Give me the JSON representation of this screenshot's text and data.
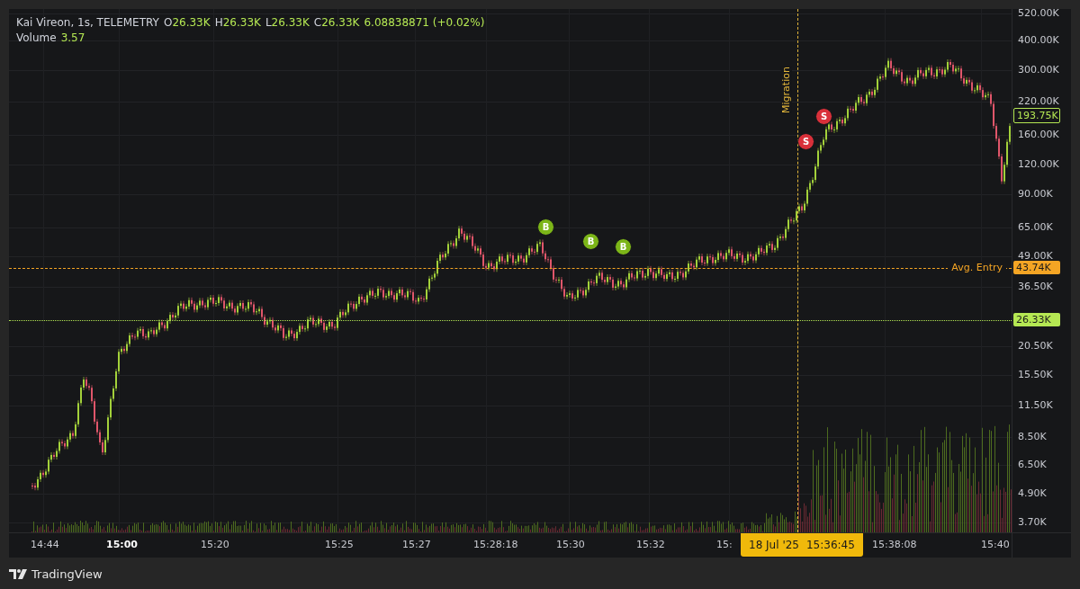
{
  "legend": {
    "title": "Kai Vireon, 1s, TELEMETRY",
    "ohlc": [
      {
        "label": "O",
        "value": "26.33K"
      },
      {
        "label": "H",
        "value": "26.33K"
      },
      {
        "label": "L",
        "value": "26.33K"
      },
      {
        "label": "C",
        "value": "26.33K"
      }
    ],
    "change": "6.08838871 (+0.02%)",
    "volume_label": "Volume",
    "volume_value": "3.57"
  },
  "price_axis": {
    "ticks": [
      "520.00K",
      "400.00K",
      "300.00K",
      "220.00K",
      "160.00K",
      "120.00K",
      "90.00K",
      "65.00K",
      "49.00K",
      "36.50K",
      "20.50K",
      "15.50K",
      "11.50K",
      "8.50K",
      "6.50K",
      "4.90K",
      "3.70K"
    ]
  },
  "price_lines": [
    {
      "kind": "current",
      "value": "193.75K"
    },
    {
      "kind": "avg_entry",
      "label": "Avg. Entry",
      "value": "43.74K"
    },
    {
      "kind": "last",
      "value": "26.33K"
    }
  ],
  "markers": [
    {
      "kind": "buy",
      "text": "B"
    },
    {
      "kind": "buy",
      "text": "B"
    },
    {
      "kind": "buy",
      "text": "B"
    },
    {
      "kind": "sell",
      "text": "S"
    },
    {
      "kind": "sell",
      "text": "S"
    }
  ],
  "event": {
    "label": "Migration"
  },
  "time_axis": {
    "labels": [
      {
        "text": "14:44",
        "emphasized": false
      },
      {
        "text": "15:00",
        "emphasized": true
      },
      {
        "text": "15:20",
        "emphasized": false
      },
      {
        "text": "15:25",
        "emphasized": false
      },
      {
        "text": "15:27",
        "emphasized": false
      },
      {
        "text": "15:28:18",
        "emphasized": false
      },
      {
        "text": "15:30",
        "emphasized": false
      },
      {
        "text": "15:32",
        "emphasized": false
      },
      {
        "text": "15:",
        "emphasized": false
      },
      {
        "text": "15:38:08",
        "emphasized": false
      },
      {
        "text": "15:40",
        "emphasized": false
      }
    ],
    "crosshair": {
      "date": "18 Jul '25",
      "time": "15:36:45"
    }
  },
  "branding": "TradingView"
}
